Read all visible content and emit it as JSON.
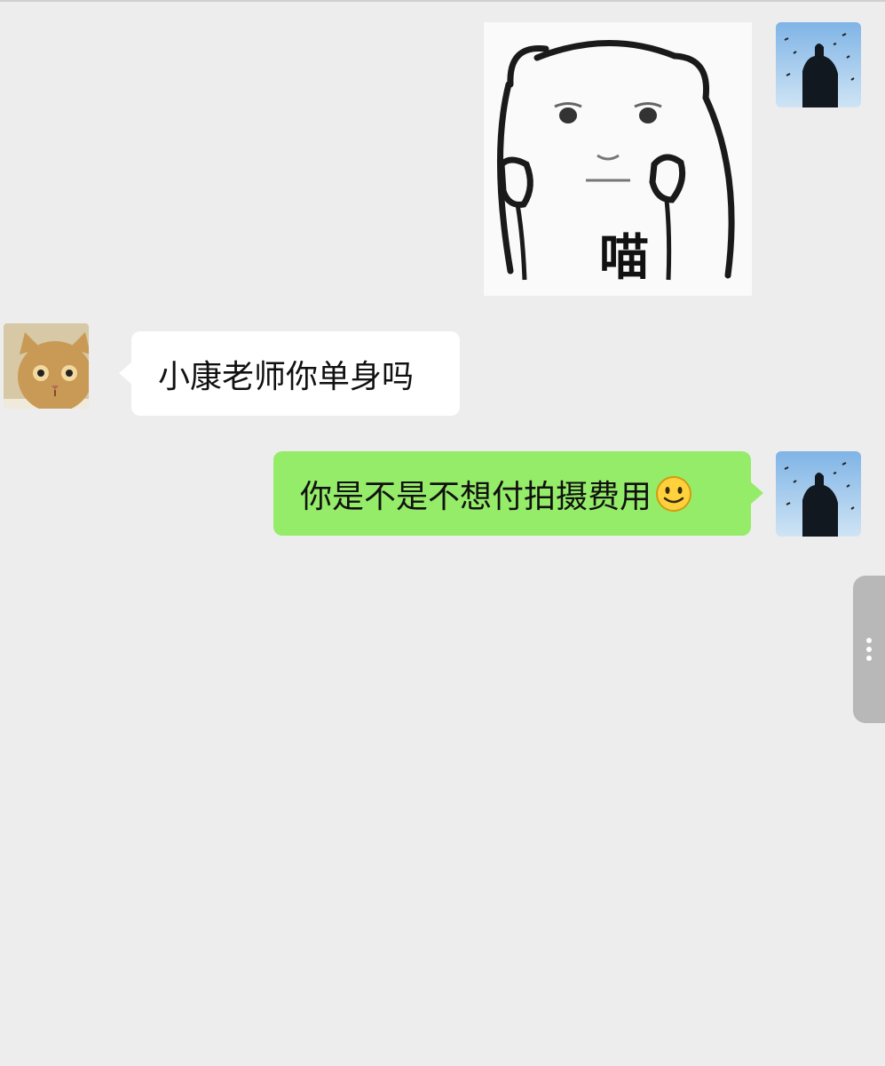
{
  "chat": {
    "messages": [
      {
        "sender": "me",
        "type": "sticker",
        "sticker_text": "喵",
        "avatar_icon": "silhouette-sky-avatar"
      },
      {
        "sender": "other",
        "type": "text",
        "text": "小康老师你单身吗",
        "avatar_icon": "cat-avatar"
      },
      {
        "sender": "me",
        "type": "text",
        "text": "你是不是不想付拍摄费用",
        "emoji": "smile-emoji",
        "avatar_icon": "silhouette-sky-avatar"
      }
    ]
  },
  "colors": {
    "background": "#ededed",
    "incoming_bubble": "#ffffff",
    "outgoing_bubble": "#95ec69",
    "side_handle": "#b8b8b8"
  },
  "side_panel": {
    "icon": "more-vertical-icon"
  }
}
